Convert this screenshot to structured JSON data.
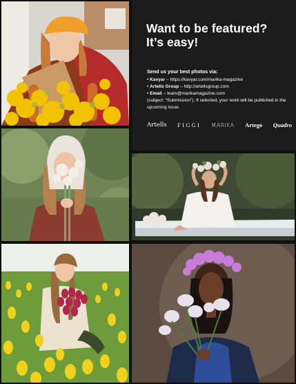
{
  "feature": {
    "headline": "Want to be featured? It’s easy!",
    "intro": "Send us your best photos via:",
    "contacts": [
      {
        "name": "Kavyar",
        "detail": " – https://kavyar.com/marika-magazine"
      },
      {
        "name": "Artells Group",
        "detail": " – http://artellsgroup.com"
      },
      {
        "name": "Email",
        "detail": " – team@marikamagazine.com"
      }
    ],
    "note": "(subject: “Submission”). If selected, your work will be published in the upcoming issue.",
    "logos": [
      "Artells",
      "FIGGI",
      "MARIKA",
      "Artego",
      "Quadro"
    ]
  },
  "colors": {
    "panel_bg": "#1b1b1b",
    "page_bg": "#0f0f0f",
    "text": "#ffffff",
    "accent_yellow": "#f2c200"
  },
  "photos": [
    "girl-orange-beret-mimosa",
    "girl-headscarf-cotton-flowers",
    "girl-flower-crown-white-bed",
    "girl-tulip-field",
    "girl-purple-flower-crown"
  ]
}
